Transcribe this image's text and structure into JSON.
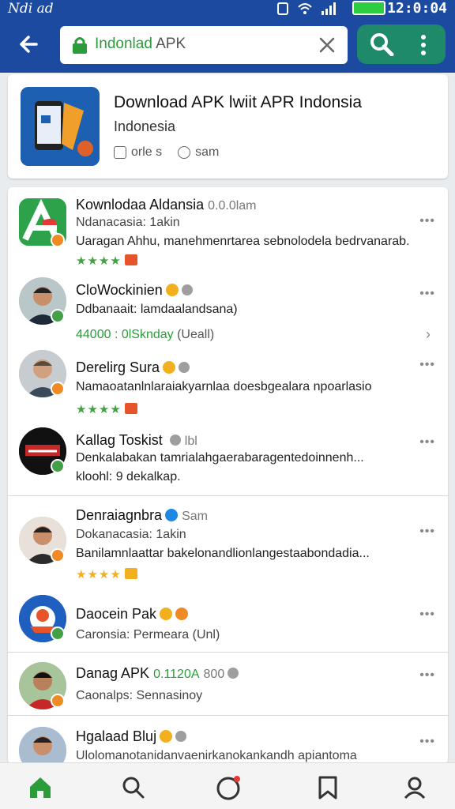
{
  "status_bar": {
    "left_text": "Ndi ad",
    "time": "12:0:04"
  },
  "search": {
    "value_highlight": "Indonlad",
    "value_rest": " APK"
  },
  "hero": {
    "title": "Download APK lwiit APR Indonsia",
    "subtitle": "Indonesia",
    "meta_1": "orle s",
    "meta_2": "sam"
  },
  "items": [
    {
      "name": "Kownlodaa Aldansia",
      "suffix": "0.0.0lam",
      "line1": "Ndanacasia: 1akin",
      "line2": "Uaragan Ahhu, manehmenrtarea sebnolodela bedrvanarab.",
      "stars": 4,
      "star_color": "green",
      "icon": "apk-app-icon"
    },
    {
      "name": "CloWockinien",
      "line1": "Ddbanaait: lamdaalandsana)",
      "line2_green": "44000 : 0lSknday",
      "line2_rest": " (Ueall)",
      "icon": "avatar"
    },
    {
      "name": "Derelirg Sura",
      "line1": "Namaoatanlnlaraiakyarnlaa doesbgealara npoarlasio",
      "stars": 4,
      "star_color": "green",
      "icon": "avatar"
    },
    {
      "name": "Kallag Toskist",
      "suffix": "lbl",
      "line1": "Denkalabakan tamrialahgaerabaragentedoinnenh...",
      "line2": "kloohl: 9 dekalkap.",
      "icon": "logo-avatar"
    },
    {
      "name": "Denraiagnbra",
      "suffix": "Sam",
      "line1": "Dokanacasia: 1akin",
      "line2": "Banilamnlaattar bakelonandlionlangestaabondadia...",
      "stars": 4,
      "star_color": "gold",
      "icon": "avatar"
    },
    {
      "name": "Daocein Pak",
      "line1": "Caronsia: Permeara (Unl)",
      "icon": "cartoon-avatar"
    },
    {
      "name": "Danag APK",
      "tag": "0.1120A",
      "suffix": "800",
      "line1": "Caonalps: Sennasinoy",
      "icon": "avatar"
    },
    {
      "name": "Hgalaad Bluj",
      "line1": "Ulolomanotanidanvaenirkanokankandh apiantoma",
      "icon": "avatar"
    }
  ],
  "more_label": "•••",
  "chevron": "›",
  "colors": {
    "topbar": "#1b4aa0",
    "accent_green": "#2a9d3a",
    "search_button": "#1f8a6a"
  },
  "nav": [
    "home-icon",
    "search-icon",
    "discover-icon",
    "bookmark-icon",
    "profile-icon"
  ]
}
